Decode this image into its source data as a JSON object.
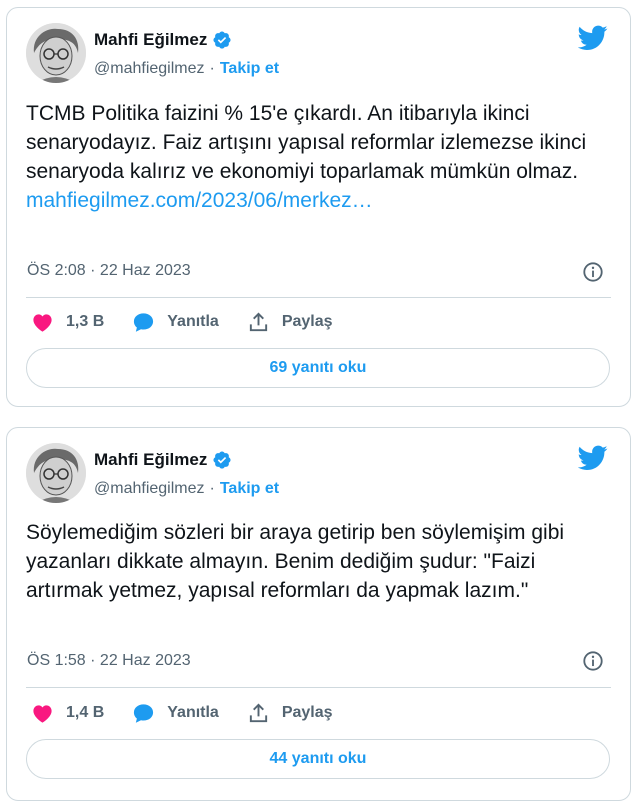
{
  "tweets": [
    {
      "author": "Mahfi Eğilmez",
      "handle": "@mahfiegilmez",
      "separator": "·",
      "follow_label": "Takip et",
      "text": "TCMB Politika faizini % 15'e çıkardı. An itibarıyla ikinci senaryodayız. Faiz artışını yapısal reformlar izlemezse ikinci senaryoda kalırız ve ekonomiyi toparlamak mümkün olmaz.",
      "link_text": "mahfiegilmez.com/2023/06/merkez…",
      "timestamp": "ÖS 2:08 · 22 Haz 2023",
      "likes": "1,3 B",
      "reply_label": "Yanıtla",
      "share_label": "Paylaş",
      "read_replies": "69 yanıtı oku"
    },
    {
      "author": "Mahfi Eğilmez",
      "handle": "@mahfiegilmez",
      "separator": "·",
      "follow_label": "Takip et",
      "text": "Söylemediğim sözleri bir araya getirip ben söylemişim gibi yazanları dikkate almayın. Benim dediğim şudur: \"Faizi artırmak yetmez, yapısal reformları da yapmak lazım.\"",
      "link_text": "",
      "timestamp": "ÖS 1:58 · 22 Haz 2023",
      "likes": "1,4 B",
      "reply_label": "Yanıtla",
      "share_label": "Paylaş",
      "read_replies": "44 yanıtı oku"
    }
  ],
  "icons": {
    "verified": "verified-badge-icon",
    "bird": "twitter-bird-icon",
    "info": "info-icon",
    "like": "heart-icon",
    "reply": "speech-bubble-icon",
    "share": "share-icon"
  },
  "colors": {
    "accent": "#1d9bf0",
    "like": "#f91880",
    "text": "#0f1419",
    "muted": "#536471",
    "border": "#cfd9de"
  }
}
